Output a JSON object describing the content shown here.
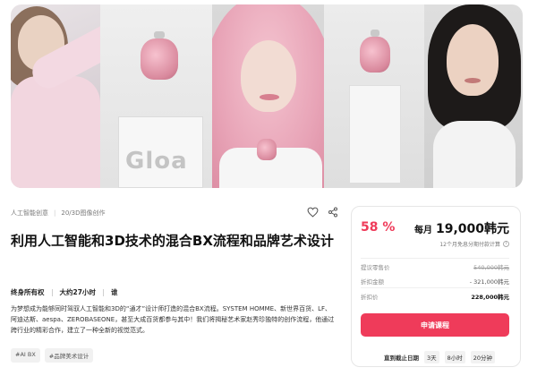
{
  "hero": {
    "brand_text": "Gloa"
  },
  "breadcrumb": {
    "category": "人工智能创意",
    "subcategory": "20/3D图像创作"
  },
  "course": {
    "title": "利用人工智能和3D技术的混合BX流程和品牌艺术设计",
    "meta": [
      "终身所有权",
      "大约27小时",
      "谁"
    ],
    "description": "为梦想成为能够同时驾驭人工智能和3D的“通才”设计师打造的混合BX流程。SYSTEM HOMME、新世界百货、LF、阿迪达斯、aespa、ZEROBASEONE，甚至大成百货都参与其中！我们将揭秘艺术家赵秀珍独特的创作流程，他通过跨行业的精彩合作，建立了一种全新的视觉范式。",
    "tags": [
      "#AI BX",
      "#品牌美术设计"
    ]
  },
  "pricing": {
    "discount_pct": "58 %",
    "monthly_prefix": "每月",
    "monthly_amount": "19,000韩元",
    "installment_note": "12个月免息分期付款计算",
    "info_icon": "i",
    "rows": [
      {
        "label": "提议零售价",
        "value": "540,000韩元"
      },
      {
        "label": "折扣金额",
        "value": "- 321,000韩元"
      },
      {
        "label": "折扣价",
        "value": "228,000韩元"
      }
    ],
    "cta_label": "申请课程",
    "deadline_label": "直到截止日期",
    "deadline_parts": [
      "3天",
      "8小时",
      "20分钟"
    ]
  },
  "colors": {
    "accent": "#ef3b5a"
  },
  "icons": [
    "heart-icon",
    "share-icon",
    "info-icon"
  ]
}
